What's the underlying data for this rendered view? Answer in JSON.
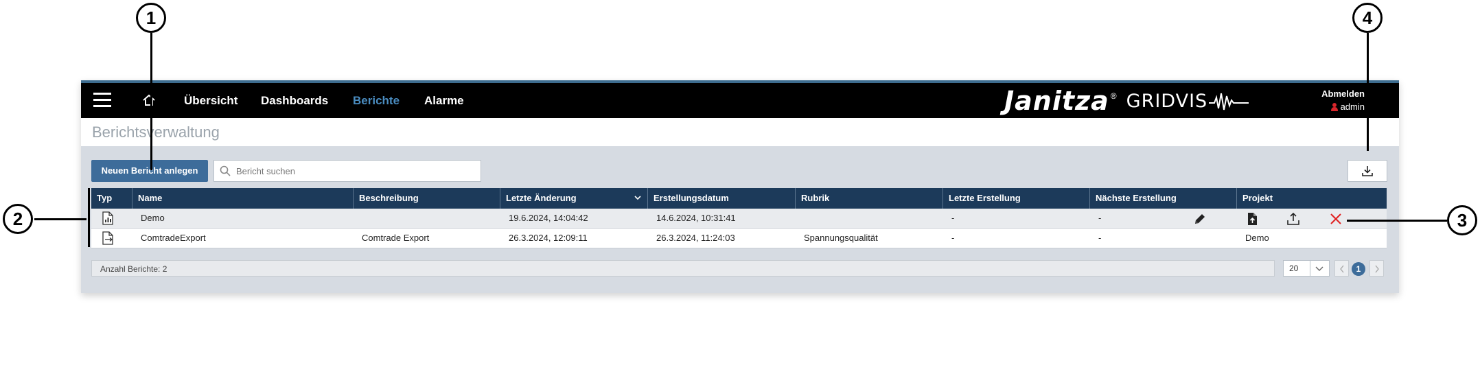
{
  "nav": {
    "items": [
      "Übersicht",
      "Dashboards",
      "Berichte",
      "Alarme"
    ],
    "active": "Berichte"
  },
  "brand": {
    "name": "Janitza",
    "reg": "®",
    "product": "GRIDVIS"
  },
  "user": {
    "logout_label": "Abmelden",
    "username": "admin"
  },
  "page": {
    "title": "Berichtsverwaltung"
  },
  "toolbar": {
    "new_report_label": "Neuen Bericht anlegen",
    "search_placeholder": "Bericht suchen"
  },
  "table": {
    "columns": [
      "Typ",
      "Name",
      "Beschreibung",
      "Letzte Änderung",
      "Erstellungsdatum",
      "Rubrik",
      "Letzte Erstellung",
      "Nächste Erstellung",
      "Projekt"
    ],
    "sorted_column": "Letzte Änderung",
    "rows": [
      {
        "type_icon": "report-document-icon",
        "name": "Demo",
        "description": "",
        "last_change": "19.6.2024, 14:04:42",
        "created": "14.6.2024, 10:31:41",
        "category": "",
        "last_creation": "-",
        "next_creation": "-",
        "project": "",
        "selected": true
      },
      {
        "type_icon": "export-document-icon",
        "name": "ComtradeExport",
        "description": "Comtrade Export",
        "last_change": "26.3.2024, 12:09:11",
        "created": "26.3.2024, 11:24:03",
        "category": "Spannungsqualität",
        "last_creation": "-",
        "next_creation": "-",
        "project": "Demo",
        "selected": false
      }
    ],
    "row_actions": [
      "edit-icon",
      "generate-report-icon",
      "upload-icon",
      "delete-icon"
    ]
  },
  "footer": {
    "count_label": "Anzahl Berichte: 2",
    "page_size": "20",
    "current_page": "1"
  },
  "callouts": [
    "1",
    "2",
    "3",
    "4"
  ],
  "colors": {
    "accent": "#3d6c9a",
    "header_bg": "#1c3a5a",
    "topbar": "#000000",
    "active_nav": "#4a8cc0",
    "delete": "#e02020"
  }
}
